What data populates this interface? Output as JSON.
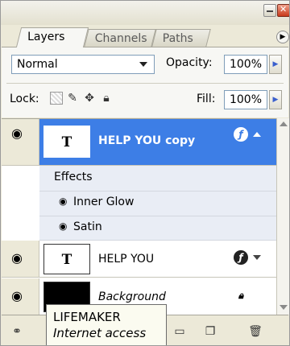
{
  "window": {
    "minimize_icon": "minimize-icon",
    "close_icon": "close-icon"
  },
  "tabs": [
    {
      "label": "Layers",
      "active": true
    },
    {
      "label": "Channels",
      "active": false
    },
    {
      "label": "Paths",
      "active": false
    }
  ],
  "blend": {
    "mode": "Normal",
    "opacity_label": "Opacity:",
    "opacity_value": "100%"
  },
  "lock": {
    "label": "Lock:",
    "fill_label": "Fill:",
    "fill_value": "100%"
  },
  "layers": [
    {
      "name": "HELP YOU copy",
      "thumb": "T",
      "selected": true,
      "fx": true
    },
    {
      "name": "HELP YOU",
      "thumb": "T",
      "selected": false,
      "fx": true
    },
    {
      "name": "Background",
      "thumb": "",
      "selected": false,
      "locked": true
    }
  ],
  "effects": {
    "label": "Effects",
    "items": [
      "Inner Glow",
      "Satin"
    ]
  },
  "tooltip": {
    "title": "LIFEMAKER",
    "subtitle": "Internet access"
  },
  "colors": {
    "selection": "#3d7ee6",
    "panel": "#ece9d8"
  }
}
